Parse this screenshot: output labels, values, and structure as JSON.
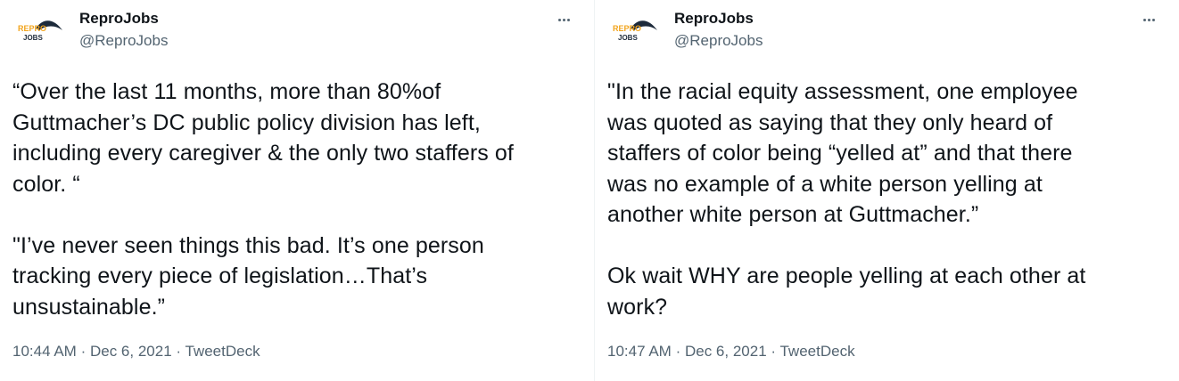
{
  "tweets": [
    {
      "display_name": "ReproJobs",
      "handle": "@ReproJobs",
      "logo_text_top": "REPRO",
      "logo_text_bottom": "JOBS",
      "body": "“Over the last 11 months, more than 80%of\nGuttmacher’s DC public policy division has left,\nincluding every caregiver & the only two staffers of\ncolor. “\n\n\"I’ve never seen things this bad. It’s one person\ntracking every piece of legislation…That’s\nunsustainable.”",
      "time": "10:44 AM",
      "date": "Dec 6, 2021",
      "source": "TweetDeck",
      "separator": "·"
    },
    {
      "display_name": "ReproJobs",
      "handle": "@ReproJobs",
      "logo_text_top": "REPRO",
      "logo_text_bottom": "JOBS",
      "body": "\"In the racial equity assessment, one employee\nwas quoted as saying that they only heard of\nstaffers of color being “yelled at” and that there\nwas no example of a white person yelling at\nanother white person at Guttmacher.”\n\nOk wait WHY are people yelling at each other at\nwork?",
      "time": "10:47 AM",
      "date": "Dec 6, 2021",
      "source": "TweetDeck",
      "separator": "·"
    }
  ],
  "colors": {
    "text": "#0f1419",
    "secondary": "#536471",
    "logo_orange": "#f2a41c",
    "logo_dark": "#1d2a3a"
  },
  "icons": {
    "more": "more-horizontal-icon"
  }
}
